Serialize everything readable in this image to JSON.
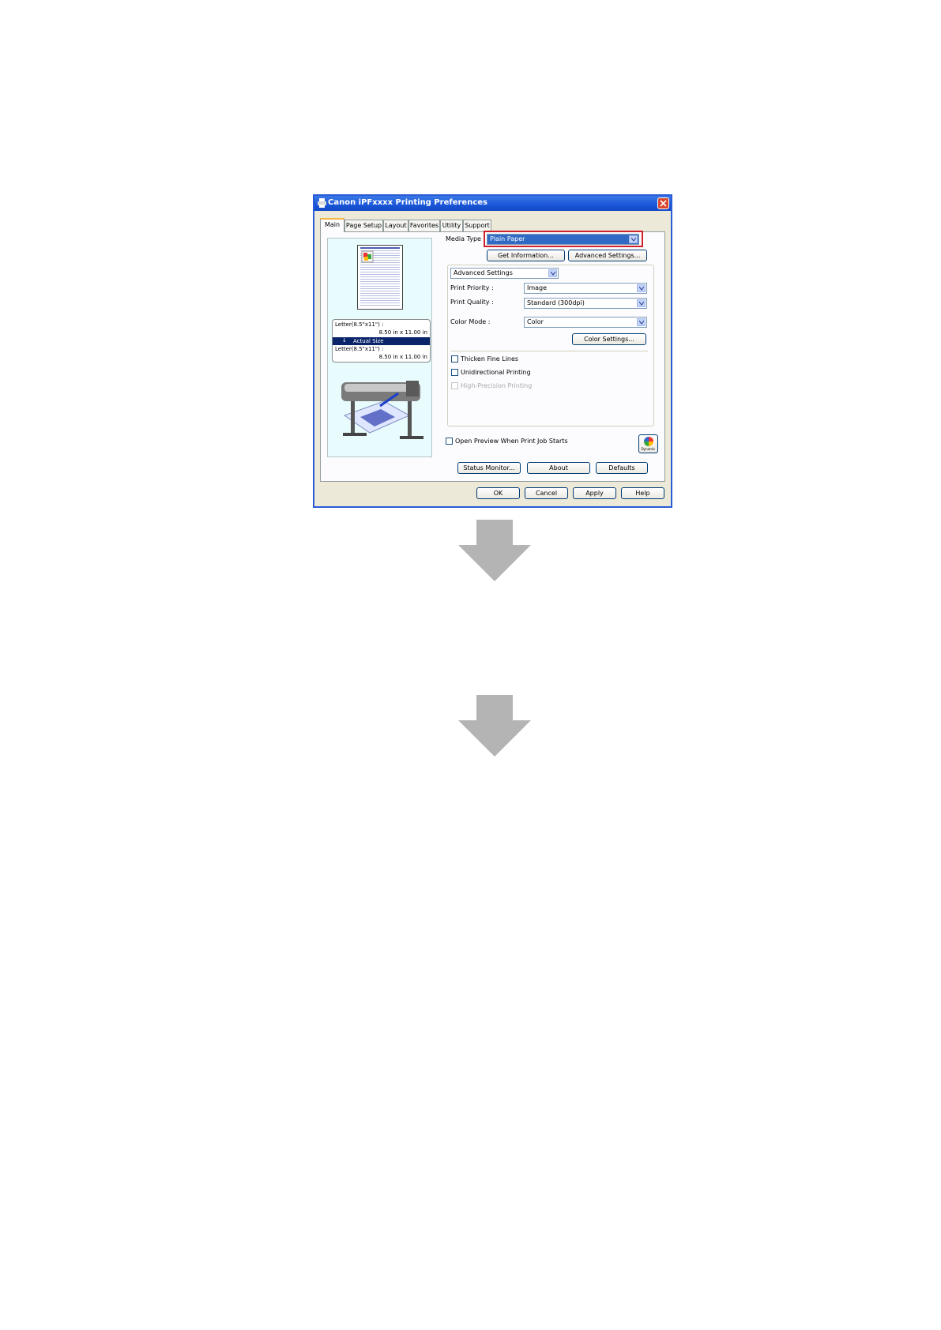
{
  "window": {
    "title": "Canon iPFxxxx Printing Preferences"
  },
  "tabs": [
    "Main",
    "Page Setup",
    "Layout",
    "Favorites",
    "Utility",
    "Support"
  ],
  "media_type": {
    "label": "Media Type :",
    "value": "Plain Paper"
  },
  "buttons": {
    "get_information": "Get Information...",
    "advanced_settings": "Advanced Settings...",
    "color_settings": "Color Settings...",
    "status_monitor": "Status Monitor...",
    "about": "About",
    "defaults": "Defaults",
    "ok": "OK",
    "cancel": "Cancel",
    "apply": "Apply",
    "help": "Help"
  },
  "mode_select": {
    "value": "Advanced Settings"
  },
  "print_priority": {
    "label": "Print Priority :",
    "value": "Image"
  },
  "print_quality": {
    "label": "Print Quality :",
    "value": "Standard (300dpi)"
  },
  "color_mode": {
    "label": "Color Mode :",
    "value": "Color"
  },
  "checkboxes": {
    "thicken_fine_lines": "Thicken Fine Lines",
    "unidirectional_printing": "Unidirectional Printing",
    "high_precision_printing": "High-Precision Printing",
    "open_preview": "Open Preview When Print Job Starts"
  },
  "size_info": {
    "source_size": "Letter(8.5\"x11\") :",
    "source_dims": "8.50 in x 11.00 in",
    "scaling": "Actual Size",
    "output_size": "Letter(8.5\"x11\") :",
    "output_dims": "8.50 in x 11.00 in"
  },
  "icons": {
    "colors_icon_label": "Dynamic"
  },
  "colors": {
    "title_bar": "#1a56d8",
    "highlight": "#316ac5",
    "red_frame": "#d0202a",
    "arrow_gray": "#b4b4b4"
  }
}
